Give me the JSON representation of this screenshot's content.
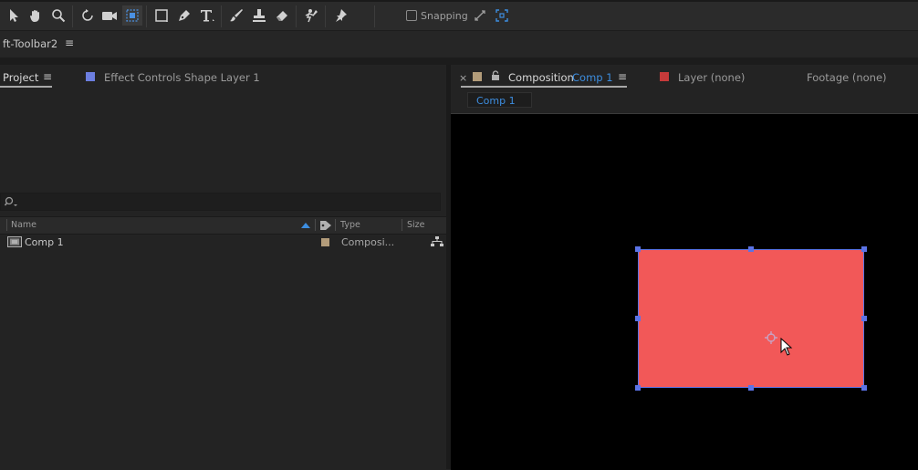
{
  "toolbar": {
    "tools": [
      "selection-tool",
      "hand-tool",
      "zoom-tool",
      "rotation-tool",
      "camera-tool",
      "pan-behind-tool",
      "rectangle-tool",
      "pen-tool",
      "type-tool",
      "brush-tool",
      "clone-stamp-tool",
      "eraser-tool",
      "roto-brush-tool",
      "puppet-pin-tool"
    ],
    "snapping_label": "Snapping",
    "snapping_checked": false
  },
  "workspace": {
    "name": "ft-Toolbar2",
    "menu_glyph": "≡"
  },
  "project_panel": {
    "tab_project": "Project",
    "tab_menu_glyph": "≡",
    "tab_effect_controls": "Effect Controls Shape Layer 1",
    "effect_controls_color": "#6c7ee0",
    "columns": {
      "name": "Name",
      "type": "Type",
      "size": "Size"
    },
    "items": [
      {
        "name": "Comp 1",
        "type": "Composi...",
        "label_color": "#b39c7a"
      }
    ]
  },
  "comp_panel": {
    "close_glyph": "×",
    "label_color": "#b39c7a",
    "tab_composition_prefix": "Composition",
    "tab_composition_name": "Comp 1",
    "tab_menu_glyph": "≡",
    "tab_layer": "Layer (none)",
    "layer_color": "#c63a3a",
    "tab_footage": "Footage (none)",
    "breadcrumb": "Comp 1",
    "accent": "#3d8ee0"
  },
  "shape_layer": {
    "fill": "#f25858",
    "handle_color": "#5b73e6"
  }
}
